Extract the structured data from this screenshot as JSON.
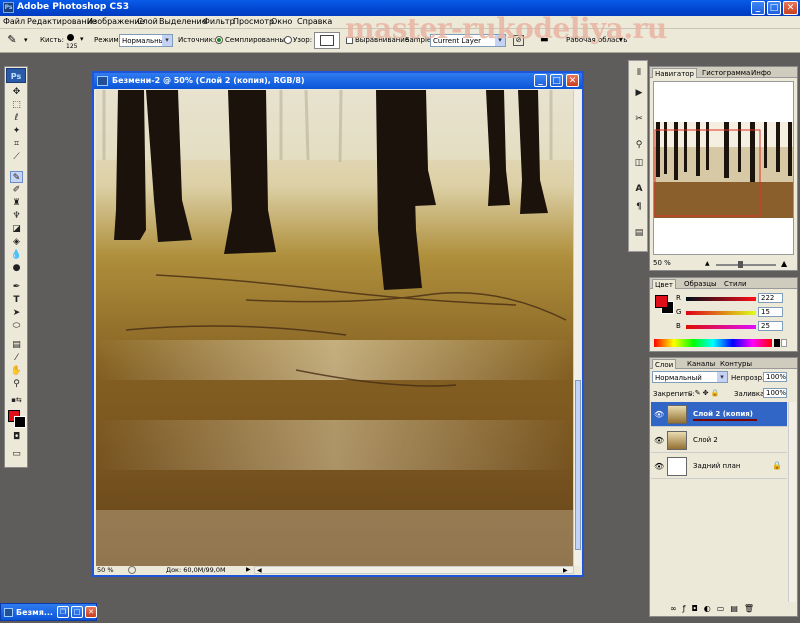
{
  "app": {
    "title": "Adobe Photoshop CS3",
    "watermark": "master-rukodeliya.ru"
  },
  "menu": [
    "Файл",
    "Редактирование",
    "Изображение",
    "Слой",
    "Выделение",
    "Фильтр",
    "Просмотр",
    "Окно",
    "Справка"
  ],
  "options": {
    "brush_label": "Кисть:",
    "brush_size": "125",
    "mode_label": "Режим:",
    "mode_value": "Нормальный",
    "source_label": "Источник:",
    "source_sampled": "Семплированный",
    "source_pattern": "Узор:",
    "aligned": "Выравнивание",
    "sample_label": "Sample:",
    "sample_value": "Current Layer",
    "workspace": "Рабочая область"
  },
  "document": {
    "title": "Безмени-2 @ 50% (Слой 2 (копия), RGB/8)",
    "zoom": "50 %",
    "doc_size": "Док: 60,0M/99,0M"
  },
  "navigator": {
    "tabs": [
      "Навигатор",
      "Гистограмма",
      "Инфо"
    ],
    "zoom": "50 %"
  },
  "color": {
    "tabs": [
      "Цвет",
      "Образцы",
      "Стили"
    ],
    "foreground": "#de0f19",
    "r_label": "R",
    "r": "222",
    "g_label": "G",
    "g": "15",
    "b_label": "B",
    "b": "25"
  },
  "layers": {
    "tabs": [
      "Слои",
      "Каналы",
      "Контуры"
    ],
    "blend": "Нормальный",
    "opacity_label": "Непрозр.:",
    "opacity": "100%",
    "lock_label": "Закрепить:",
    "fill_label": "Заливка:",
    "fill": "100%",
    "items": [
      {
        "name": "Слой 2 (копия)",
        "selected": true
      },
      {
        "name": "Слой 2",
        "selected": false
      },
      {
        "name": "Задний план",
        "selected": false
      }
    ]
  },
  "taskbar": {
    "minimized_title": "Безмя..."
  }
}
